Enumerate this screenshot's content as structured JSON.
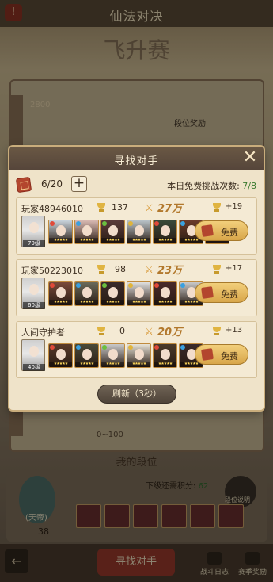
{
  "background": {
    "title": "仙法对决",
    "banner": "飞升赛",
    "score": "2800",
    "reward_label": "段位奖励",
    "range": "0~100",
    "section_title": "我的段位",
    "my_rank_label": "(天帝)",
    "my_score": "38",
    "next_rank_label": "下级还需积分:",
    "next_rank_value": "62",
    "rank_info_label": "段位说明",
    "find_opponent": "寻找对手",
    "battle_log": "战斗日志",
    "season_reward": "赛季奖励"
  },
  "modal": {
    "title": "寻找对手",
    "tickets": "6/20",
    "plus": "+",
    "free_label": "本日免费挑战次数:",
    "free_value": "7/8",
    "refresh": "刷新（3秒）",
    "opponents": [
      {
        "name": "玩家48946010",
        "trophies": "137",
        "power": "27万",
        "reward": "+19",
        "level": "79级",
        "challenge": "免费",
        "heroes": [
          "#c9d3dc",
          "#d9b9b2",
          "#5b3b3a",
          "#b9c3c8",
          "#3a4a3a",
          "#6a3a2a",
          "#8a3a3a"
        ]
      },
      {
        "name": "玩家50223010",
        "trophies": "98",
        "power": "23万",
        "reward": "+17",
        "level": "60级",
        "challenge": "免费",
        "heroes": [
          "#7a4a3a",
          "#6a6a5a",
          "#3a2a2a",
          "#e0e0e0",
          "#4a2a2a",
          "#c9c9c9"
        ]
      },
      {
        "name": "人间守护者",
        "trophies": "0",
        "power": "20万",
        "reward": "+13",
        "level": "40级",
        "challenge": "免费",
        "heroes": [
          "#5a3a2a",
          "#4a4a3a",
          "#c9c9c9",
          "#e8e4d8",
          "#4a3a2a",
          "#3a2a2a"
        ]
      }
    ]
  }
}
